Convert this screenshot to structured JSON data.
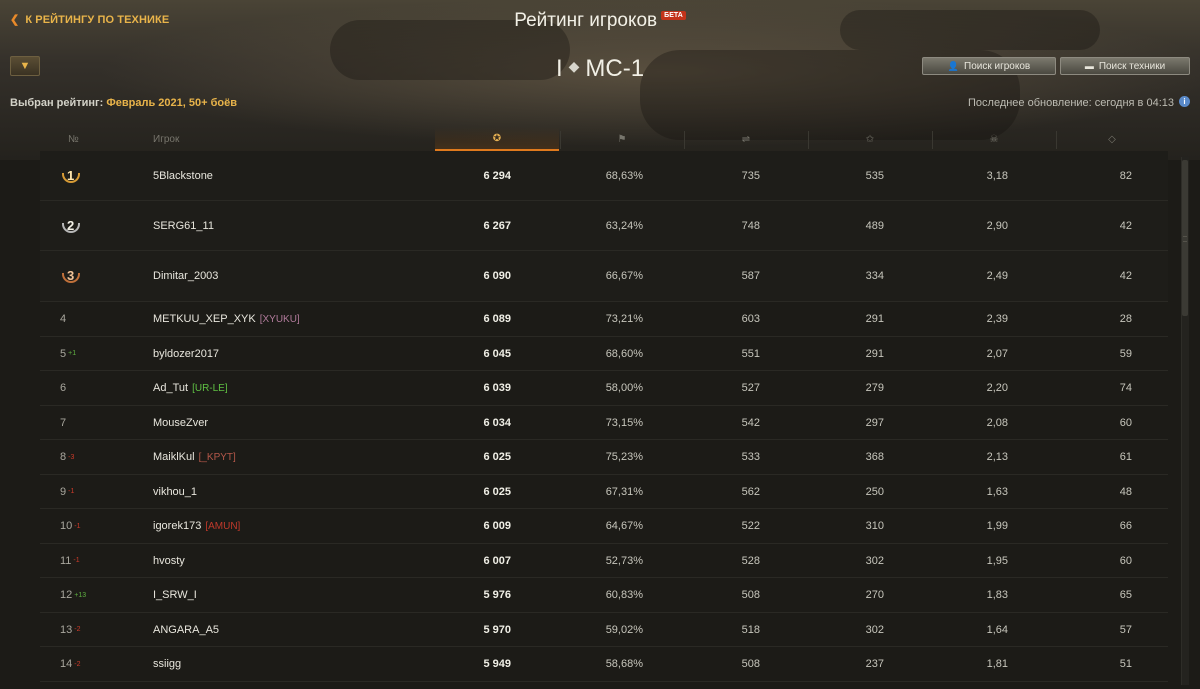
{
  "header": {
    "back_label": "К РЕЙТИНГУ ПО ТЕХНИКЕ",
    "title": "Рейтинг игроков",
    "beta": "БЕТА",
    "tier": "I",
    "vehicle": "МС-1",
    "players_search": "Поиск игроков",
    "tech_search": "Поиск техники",
    "selected_label": "Выбран рейтинг:",
    "selected_value": "Февраль 2021, 50+ боёв",
    "last_update": "Последнее обновление: сегодня в 04:13"
  },
  "columns": {
    "rank": "№",
    "player": "Игрок"
  },
  "colors": {
    "accent": "#e9b44a",
    "active_tab": "#e07a1d",
    "up": "#5fb041",
    "down": "#cc3b2a"
  },
  "rows": [
    {
      "rank": "1",
      "medal": "gold",
      "name": "5Blackstone",
      "clan": "",
      "clan_color": "",
      "delta": "",
      "delta_dir": "",
      "rating": "6 294",
      "win": "68,63%",
      "dmg": "735",
      "exp": "535",
      "frags": "3,18",
      "spot": "82"
    },
    {
      "rank": "2",
      "medal": "silver",
      "name": "SERG61_11",
      "clan": "",
      "clan_color": "",
      "delta": "",
      "delta_dir": "",
      "rating": "6 267",
      "win": "63,24%",
      "dmg": "748",
      "exp": "489",
      "frags": "2,90",
      "spot": "42"
    },
    {
      "rank": "3",
      "medal": "bronze",
      "name": "Dimitar_2003",
      "clan": "",
      "clan_color": "",
      "delta": "",
      "delta_dir": "",
      "rating": "6 090",
      "win": "66,67%",
      "dmg": "587",
      "exp": "334",
      "frags": "2,49",
      "spot": "42"
    },
    {
      "rank": "4",
      "medal": "",
      "name": "METKUU_XEP_XYK",
      "clan": "[XYUKU]",
      "clan_color": "#b07a9a",
      "delta": "",
      "delta_dir": "",
      "rating": "6 089",
      "win": "73,21%",
      "dmg": "603",
      "exp": "291",
      "frags": "2,39",
      "spot": "28"
    },
    {
      "rank": "5",
      "medal": "",
      "name": "byldozer2017",
      "clan": "",
      "clan_color": "",
      "delta": "+1",
      "delta_dir": "up",
      "rating": "6 045",
      "win": "68,60%",
      "dmg": "551",
      "exp": "291",
      "frags": "2,07",
      "spot": "59"
    },
    {
      "rank": "6",
      "medal": "",
      "name": "Ad_Tut",
      "clan": "[UR-LE]",
      "clan_color": "#5fc043",
      "delta": "",
      "delta_dir": "",
      "rating": "6 039",
      "win": "58,00%",
      "dmg": "527",
      "exp": "279",
      "frags": "2,20",
      "spot": "74"
    },
    {
      "rank": "7",
      "medal": "",
      "name": "MouseZver",
      "clan": "",
      "clan_color": "",
      "delta": "",
      "delta_dir": "",
      "rating": "6 034",
      "win": "73,15%",
      "dmg": "542",
      "exp": "297",
      "frags": "2,08",
      "spot": "60"
    },
    {
      "rank": "8",
      "medal": "",
      "name": "MaiklKul",
      "clan": "[_KPYT]",
      "clan_color": "#b5584a",
      "delta": "-3",
      "delta_dir": "down",
      "rating": "6 025",
      "win": "75,23%",
      "dmg": "533",
      "exp": "368",
      "frags": "2,13",
      "spot": "61"
    },
    {
      "rank": "9",
      "medal": "",
      "name": "vikhou_1",
      "clan": "",
      "clan_color": "",
      "delta": "-1",
      "delta_dir": "down",
      "rating": "6 025",
      "win": "67,31%",
      "dmg": "562",
      "exp": "250",
      "frags": "1,63",
      "spot": "48"
    },
    {
      "rank": "10",
      "medal": "",
      "name": "igorek173",
      "clan": "[AMUN]",
      "clan_color": "#c0392b",
      "delta": "-1",
      "delta_dir": "down",
      "rating": "6 009",
      "win": "64,67%",
      "dmg": "522",
      "exp": "310",
      "frags": "1,99",
      "spot": "66"
    },
    {
      "rank": "11",
      "medal": "",
      "name": "hvosty",
      "clan": "",
      "clan_color": "",
      "delta": "-1",
      "delta_dir": "down",
      "rating": "6 007",
      "win": "52,73%",
      "dmg": "528",
      "exp": "302",
      "frags": "1,95",
      "spot": "60"
    },
    {
      "rank": "12",
      "medal": "",
      "name": "I_SRW_I",
      "clan": "",
      "clan_color": "",
      "delta": "+13",
      "delta_dir": "up",
      "rating": "5 976",
      "win": "60,83%",
      "dmg": "508",
      "exp": "270",
      "frags": "1,83",
      "spot": "65"
    },
    {
      "rank": "13",
      "medal": "",
      "name": "ANGARA_A5",
      "clan": "",
      "clan_color": "",
      "delta": "-2",
      "delta_dir": "down",
      "rating": "5 970",
      "win": "59,02%",
      "dmg": "518",
      "exp": "302",
      "frags": "1,64",
      "spot": "57"
    },
    {
      "rank": "14",
      "medal": "",
      "name": "ssiigg",
      "clan": "",
      "clan_color": "",
      "delta": "-2",
      "delta_dir": "down",
      "rating": "5 949",
      "win": "58,68%",
      "dmg": "508",
      "exp": "237",
      "frags": "1,81",
      "spot": "51"
    }
  ]
}
